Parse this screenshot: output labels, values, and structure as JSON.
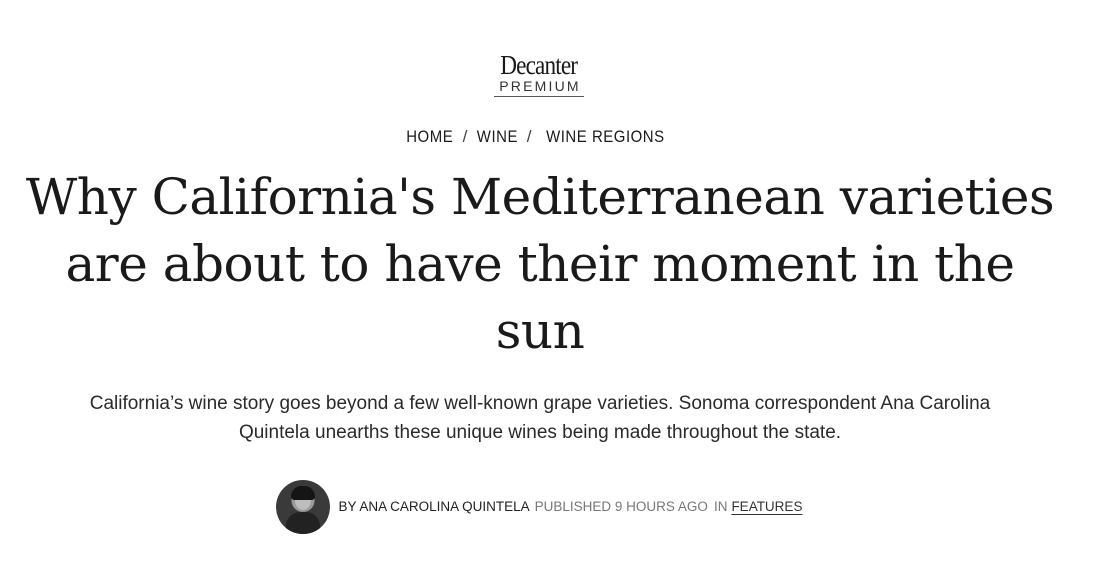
{
  "logo": {
    "wordmark": "Decanter",
    "tagline": "PREMIUM"
  },
  "breadcrumb": {
    "items": [
      "HOME",
      "WINE",
      "WINE REGIONS"
    ],
    "separator": "/"
  },
  "article": {
    "headline": "Why California's Mediterranean varieties are about to have their moment in the sun",
    "standfirst": "California’s wine story goes beyond a few well-known grape varieties. Sonoma correspondent Ana Carolina Quintela unearths these unique wines being made throughout the state."
  },
  "byline": {
    "author": "BY ANA CAROLINA QUINTELA",
    "published": "PUBLISHED 9 HOURS AGO",
    "in_label": "IN",
    "category": "FEATURES"
  }
}
